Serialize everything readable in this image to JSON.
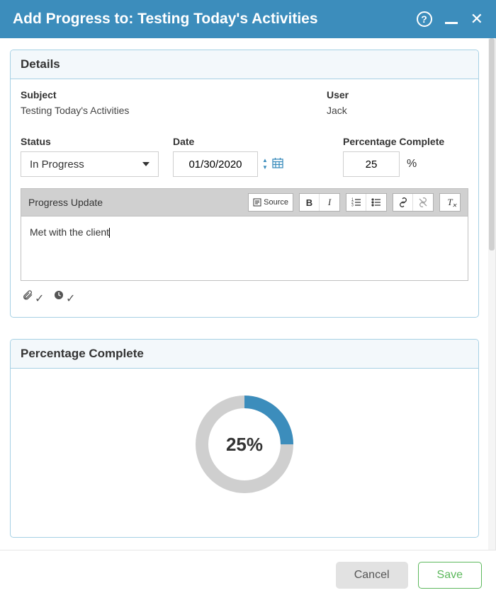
{
  "titlebar": {
    "title": "Add Progress to: Testing Today's Activities"
  },
  "panels": {
    "details": {
      "header": "Details",
      "subject_label": "Subject",
      "subject_value": "Testing Today's Activities",
      "user_label": "User",
      "user_value": "Jack",
      "status_label": "Status",
      "status_value": "In Progress",
      "date_label": "Date",
      "date_value": "01/30/2020",
      "pct_label": "Percentage Complete",
      "pct_value": "25",
      "pct_suffix": "%",
      "progress_update_label": "Progress Update",
      "toolbar": {
        "source": "Source"
      },
      "progress_update_text": "Met with the client"
    },
    "pct_panel": {
      "header": "Percentage Complete"
    }
  },
  "chart_data": {
    "type": "pie",
    "title": "Percentage Complete",
    "value": 25,
    "max": 100,
    "display": "25%",
    "colors": {
      "complete": "#3c8dbc",
      "remaining": "#cfcfcf"
    }
  },
  "footer": {
    "cancel": "Cancel",
    "save": "Save"
  }
}
